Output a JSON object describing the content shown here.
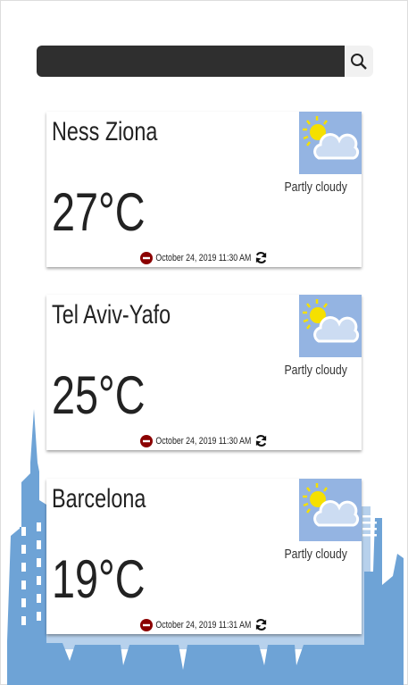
{
  "search": {
    "value": "",
    "placeholder": ""
  },
  "cities": [
    {
      "name": "Ness Ziona",
      "temperature": "27°C",
      "condition": "Partly cloudy",
      "updated": "October 24, 2019 11:30 AM"
    },
    {
      "name": "Tel Aviv-Yafo",
      "temperature": "25°C",
      "condition": "Partly cloudy",
      "updated": "October 24, 2019 11:30 AM"
    },
    {
      "name": "Barcelona",
      "temperature": "19°C",
      "condition": "Partly cloudy",
      "updated": "October 24, 2019 11:31 AM"
    }
  ],
  "colors": {
    "skyline": "#6ea3d6",
    "skyline_light": "#b7d1ec",
    "remove": "#8b0000",
    "icon_bg": "#94b4e2"
  }
}
